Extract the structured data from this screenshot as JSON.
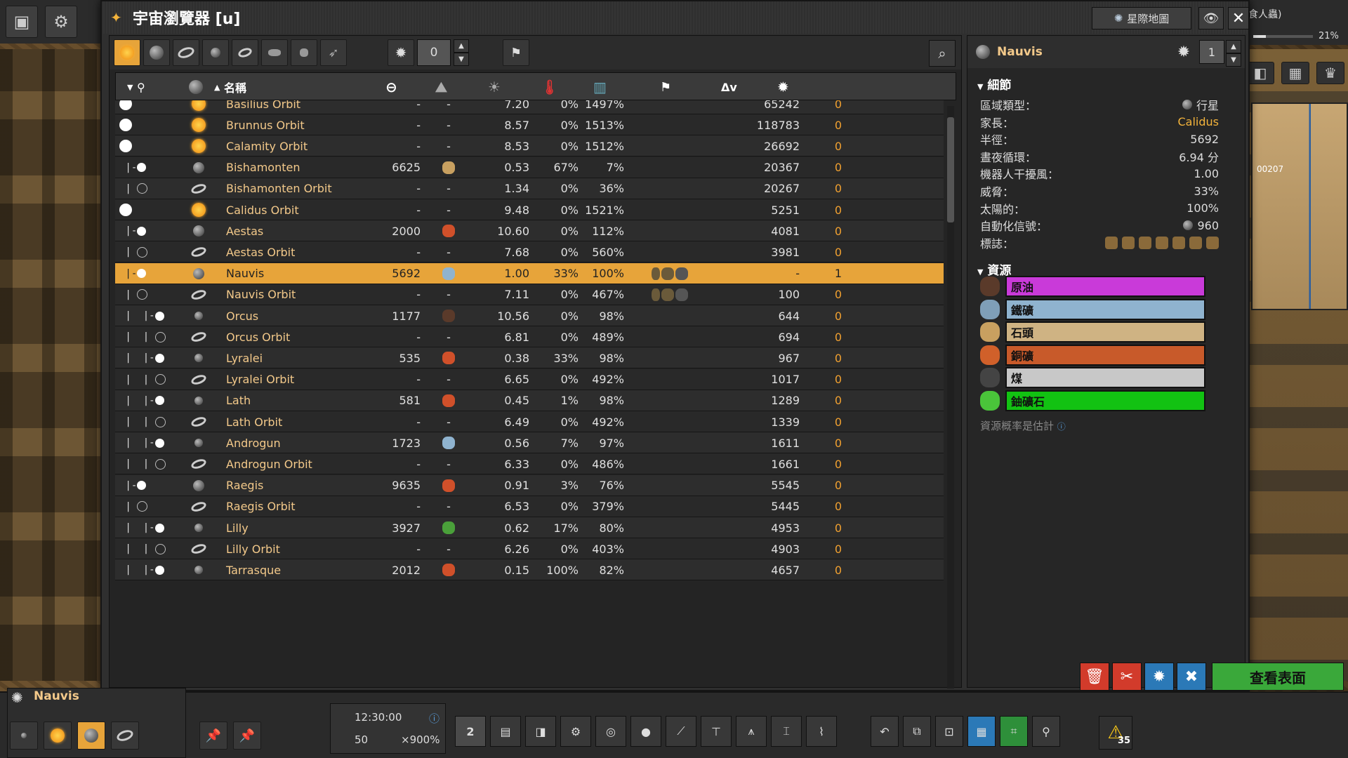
{
  "window": {
    "title": "宇宙瀏覽器 [u]",
    "starmap_label": "星際地圖",
    "close_glyph": "✕",
    "eye_glyph": "👁"
  },
  "filters": {
    "threat_value": "0",
    "icons": [
      "sun-icon",
      "planet-icon",
      "orbit-icon",
      "moon-icon",
      "belt-icon",
      "asteroid-icon",
      "field-icon",
      "spaceship-icon"
    ]
  },
  "columns": {
    "name": "名稱",
    "delta_v": "Δv"
  },
  "rows": [
    {
      "tree": "",
      "type": "star",
      "name": "Basilius Orbit",
      "radius": "-",
      "res": "-",
      "day": "7.20",
      "threat": "0%",
      "solar": "1497%",
      "dv": "65242",
      "pri": "0"
    },
    {
      "tree": "",
      "type": "star",
      "name": "Brunnus Orbit",
      "radius": "-",
      "res": "-",
      "day": "8.57",
      "threat": "0%",
      "solar": "1513%",
      "dv": "118783",
      "pri": "0"
    },
    {
      "tree": "",
      "type": "star",
      "name": "Calamity Orbit",
      "radius": "-",
      "res": "-",
      "day": "8.53",
      "threat": "0%",
      "solar": "1512%",
      "dv": "26692",
      "pri": "0"
    },
    {
      "tree": " |-",
      "type": "planet",
      "name": "Bishamonten",
      "radius": "6625",
      "res": "stone",
      "day": "0.53",
      "threat": "67%",
      "solar": "7%",
      "dv": "20367",
      "pri": "0"
    },
    {
      "tree": " | ",
      "type": "orbit",
      "name": "Bishamonten Orbit",
      "radius": "-",
      "res": "-",
      "day": "1.34",
      "threat": "0%",
      "solar": "36%",
      "dv": "20267",
      "pri": "0"
    },
    {
      "tree": "",
      "type": "star",
      "name": "Calidus Orbit",
      "radius": "-",
      "res": "-",
      "day": "9.48",
      "threat": "0%",
      "solar": "1521%",
      "dv": "5251",
      "pri": "0"
    },
    {
      "tree": " |-",
      "type": "planet",
      "name": "Aestas",
      "radius": "2000",
      "res": "copper",
      "day": "10.60",
      "threat": "0%",
      "solar": "112%",
      "dv": "4081",
      "pri": "0"
    },
    {
      "tree": " | ",
      "type": "orbit",
      "name": "Aestas Orbit",
      "radius": "-",
      "res": "-",
      "day": "7.68",
      "threat": "0%",
      "solar": "560%",
      "dv": "3981",
      "pri": "0"
    },
    {
      "tree": " |-",
      "type": "planet",
      "name": "Nauvis",
      "radius": "5692",
      "res": "iron",
      "day": "1.00",
      "threat": "33%",
      "solar": "100%",
      "dv": "-",
      "pri": "1",
      "selected": true,
      "sig": true
    },
    {
      "tree": " | ",
      "type": "orbit",
      "name": "Nauvis Orbit",
      "radius": "-",
      "res": "-",
      "day": "7.11",
      "threat": "0%",
      "solar": "467%",
      "dv": "100",
      "pri": "0",
      "sig": true
    },
    {
      "tree": " |  |-",
      "type": "moon",
      "name": "Orcus",
      "radius": "1177",
      "res": "oil",
      "day": "10.56",
      "threat": "0%",
      "solar": "98%",
      "dv": "644",
      "pri": "0"
    },
    {
      "tree": " |  | ",
      "type": "orbit",
      "name": "Orcus Orbit",
      "radius": "-",
      "res": "-",
      "day": "6.81",
      "threat": "0%",
      "solar": "489%",
      "dv": "694",
      "pri": "0"
    },
    {
      "tree": " |  |-",
      "type": "moon",
      "name": "Lyralei",
      "radius": "535",
      "res": "copper",
      "day": "0.38",
      "threat": "33%",
      "solar": "98%",
      "dv": "967",
      "pri": "0"
    },
    {
      "tree": " |  | ",
      "type": "orbit",
      "name": "Lyralei Orbit",
      "radius": "-",
      "res": "-",
      "day": "6.65",
      "threat": "0%",
      "solar": "492%",
      "dv": "1017",
      "pri": "0"
    },
    {
      "tree": " |  |-",
      "type": "moon",
      "name": "Lath",
      "radius": "581",
      "res": "copper",
      "day": "0.45",
      "threat": "1%",
      "solar": "98%",
      "dv": "1289",
      "pri": "0"
    },
    {
      "tree": " |  | ",
      "type": "orbit",
      "name": "Lath Orbit",
      "radius": "-",
      "res": "-",
      "day": "6.49",
      "threat": "0%",
      "solar": "492%",
      "dv": "1339",
      "pri": "0"
    },
    {
      "tree": " |  |-",
      "type": "moon",
      "name": "Androgun",
      "radius": "1723",
      "res": "iron",
      "day": "0.56",
      "threat": "7%",
      "solar": "97%",
      "dv": "1611",
      "pri": "0"
    },
    {
      "tree": " |  | ",
      "type": "orbit",
      "name": "Androgun Orbit",
      "radius": "-",
      "res": "-",
      "day": "6.33",
      "threat": "0%",
      "solar": "486%",
      "dv": "1661",
      "pri": "0"
    },
    {
      "tree": " |-",
      "type": "planet",
      "name": "Raegis",
      "radius": "9635",
      "res": "copper",
      "day": "0.91",
      "threat": "3%",
      "solar": "76%",
      "dv": "5545",
      "pri": "0"
    },
    {
      "tree": " | ",
      "type": "orbit",
      "name": "Raegis Orbit",
      "radius": "-",
      "res": "-",
      "day": "6.53",
      "threat": "0%",
      "solar": "379%",
      "dv": "5445",
      "pri": "0"
    },
    {
      "tree": " |  |-",
      "type": "moon",
      "name": "Lilly",
      "radius": "3927",
      "res": "uranium",
      "day": "0.62",
      "threat": "17%",
      "solar": "80%",
      "dv": "4953",
      "pri": "0"
    },
    {
      "tree": " |  | ",
      "type": "orbit",
      "name": "Lilly Orbit",
      "radius": "-",
      "res": "-",
      "day": "6.26",
      "threat": "0%",
      "solar": "403%",
      "dv": "4903",
      "pri": "0"
    },
    {
      "tree": " |  |-",
      "type": "moon",
      "name": "Tarrasque",
      "radius": "2012",
      "res": "copper",
      "day": "0.15",
      "threat": "100%",
      "solar": "82%",
      "dv": "4657",
      "pri": "0"
    }
  ],
  "details": {
    "planet_name": "Nauvis",
    "priority_value": "1",
    "section_details": "細節",
    "section_resources": "資源",
    "fields": [
      {
        "label": "區域類型：",
        "value": "行星"
      },
      {
        "label": "家長：",
        "value": "Calidus"
      },
      {
        "label": "半徑：",
        "value": "5692"
      },
      {
        "label": "晝夜循環：",
        "value": "6.94 分"
      },
      {
        "label": "機器人干擾風：",
        "value": "1.00"
      },
      {
        "label": "威脅：",
        "value": "33%"
      },
      {
        "label": "太陽的：",
        "value": "100%"
      },
      {
        "label": "自動化信號：",
        "value": "960"
      },
      {
        "label": "標誌：",
        "value": ""
      }
    ],
    "resources": [
      {
        "name": "原油",
        "color": "#c93ad9",
        "icon": "#5a3a2a"
      },
      {
        "name": "鐵礦",
        "color": "#8fb3cf",
        "icon": "#7f9fb8"
      },
      {
        "name": "石頭",
        "color": "#cfb383",
        "icon": "#c8a060"
      },
      {
        "name": "銅礦",
        "color": "#c85a2a",
        "icon": "#d0602a"
      },
      {
        "name": "煤",
        "color": "#c8c8c8",
        "icon": "#444444"
      },
      {
        "name": "鈾礦石",
        "color": "#12c212",
        "icon": "#4ac43a"
      }
    ],
    "estimate_note": "資源概率是估計",
    "view_surface": "查看表面"
  },
  "hud": {
    "planet_name": "Nauvis",
    "time": "12:30:00",
    "count": "50",
    "speed": "×900%",
    "quickbar_page": "2",
    "alert_count": "35",
    "top_right_text": "食人蟲)",
    "progress_pct": "21%",
    "progress_fraction": 0.21,
    "map_label": "00207"
  }
}
